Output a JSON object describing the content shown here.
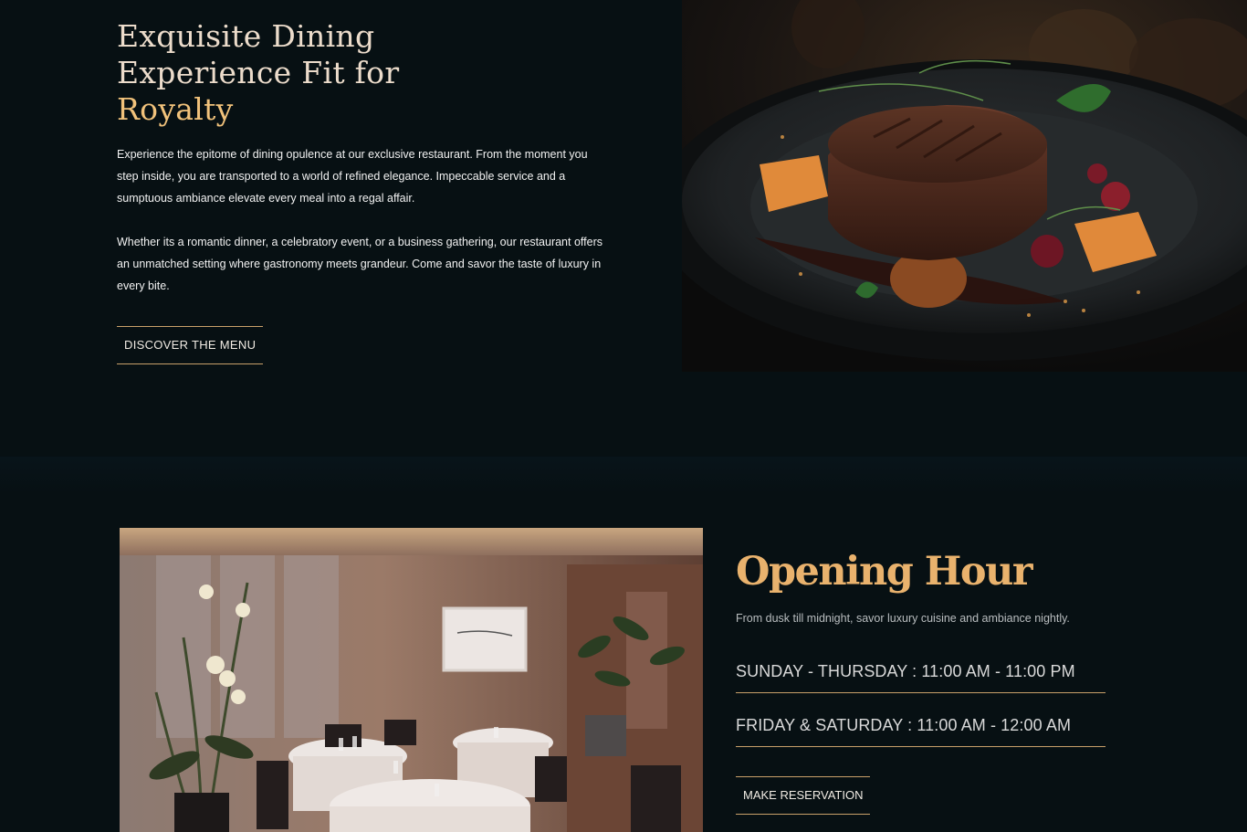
{
  "hero": {
    "title_line1": "Exquisite Dining",
    "title_line2": "Experience Fit for",
    "title_accent": "Royalty",
    "paragraph1": "Experience the epitome of dining opulence at our exclusive restaurant. From the moment you step inside, you are transported to a world of refined elegance. Impeccable service and a sumptuous ambiance elevate every meal into a regal affair.",
    "paragraph2": "Whether its a romantic dinner, a celebratory event, or a business gathering, our restaurant offers an unmatched setting where gastronomy meets grandeur. Come and savor the taste of luxury in every bite.",
    "button_label": "DISCOVER THE MENU"
  },
  "hours": {
    "title": "Opening Hour",
    "subtitle": "From dusk till midnight, savor luxury cuisine and ambiance nightly.",
    "schedule": [
      {
        "text": "SUNDAY - THURSDAY : 11:00 AM - 11:00 PM"
      },
      {
        "text": "FRIDAY & SATURDAY : 11:00 AM - 12:00 AM"
      }
    ],
    "button_label": "MAKE RESERVATION"
  },
  "colors": {
    "background": "#071013",
    "accent_gold": "#e9b26d",
    "title_cream": "#ecdccb"
  }
}
